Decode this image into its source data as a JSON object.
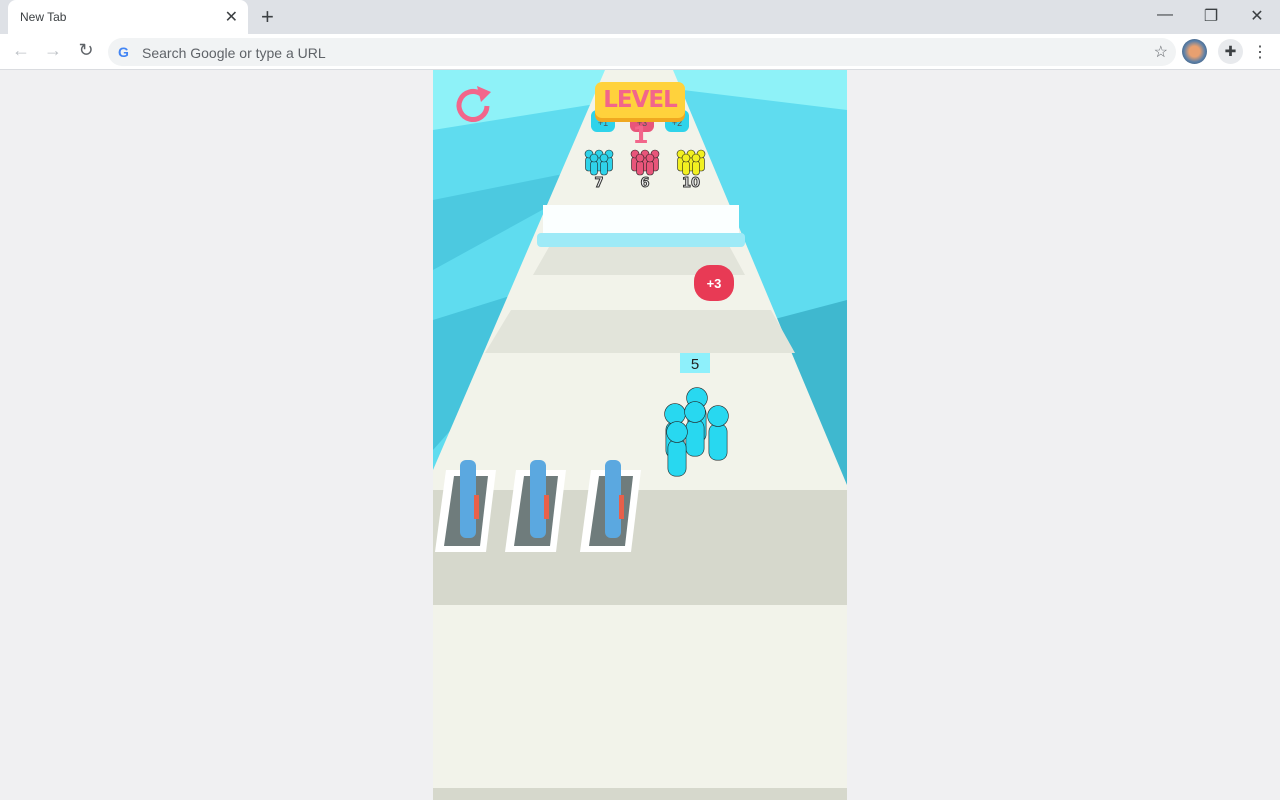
{
  "browser": {
    "tab_title": "New Tab",
    "tab_close": "✕",
    "new_tab": "+",
    "omnibox_placeholder": "Search Google or type a URL",
    "window_controls": {
      "minimize": "—",
      "restore": "❐",
      "close": "✕"
    },
    "icons": [
      "back-icon",
      "forward-icon",
      "reload-icon",
      "google-icon",
      "star-icon",
      "avatar",
      "extensions-icon",
      "menu-icon"
    ]
  },
  "game": {
    "level_label": "LEVEL 1",
    "gates": [
      "+1",
      "+3",
      "+2"
    ],
    "crowds": [
      {
        "count": "7",
        "color": "#2fd3ea"
      },
      {
        "count": "6",
        "color": "#e8557a"
      },
      {
        "count": "10",
        "color": "#f2f020"
      }
    ],
    "bonus_bubble": "+3",
    "player_count": "5",
    "colors": {
      "sky": "#5fdcef",
      "road": "#f2f3ea",
      "player": "#28d8f0",
      "level_badge": "#ffd23c",
      "level_text": "#f2668b",
      "restart": "#f2668b"
    }
  }
}
